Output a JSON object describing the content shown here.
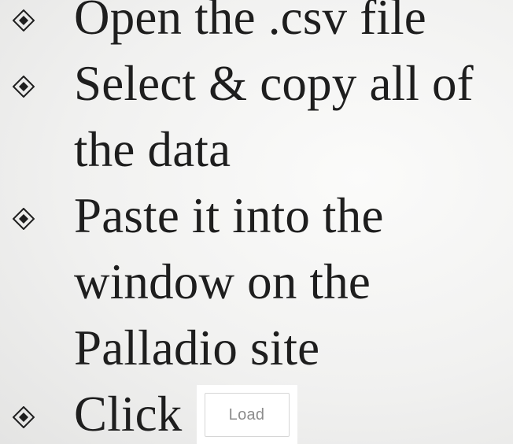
{
  "slide": {
    "bullets": [
      {
        "icon": "diamond-bullet-icon",
        "text": "Open the .csv file"
      },
      {
        "icon": "diamond-bullet-icon",
        "text": "Select & copy all of the data"
      },
      {
        "icon": "diamond-bullet-icon",
        "text": "Paste it into the window on the Palladio site"
      },
      {
        "icon": "diamond-bullet-icon",
        "text": "Click"
      }
    ],
    "load_button_label": "Load"
  }
}
